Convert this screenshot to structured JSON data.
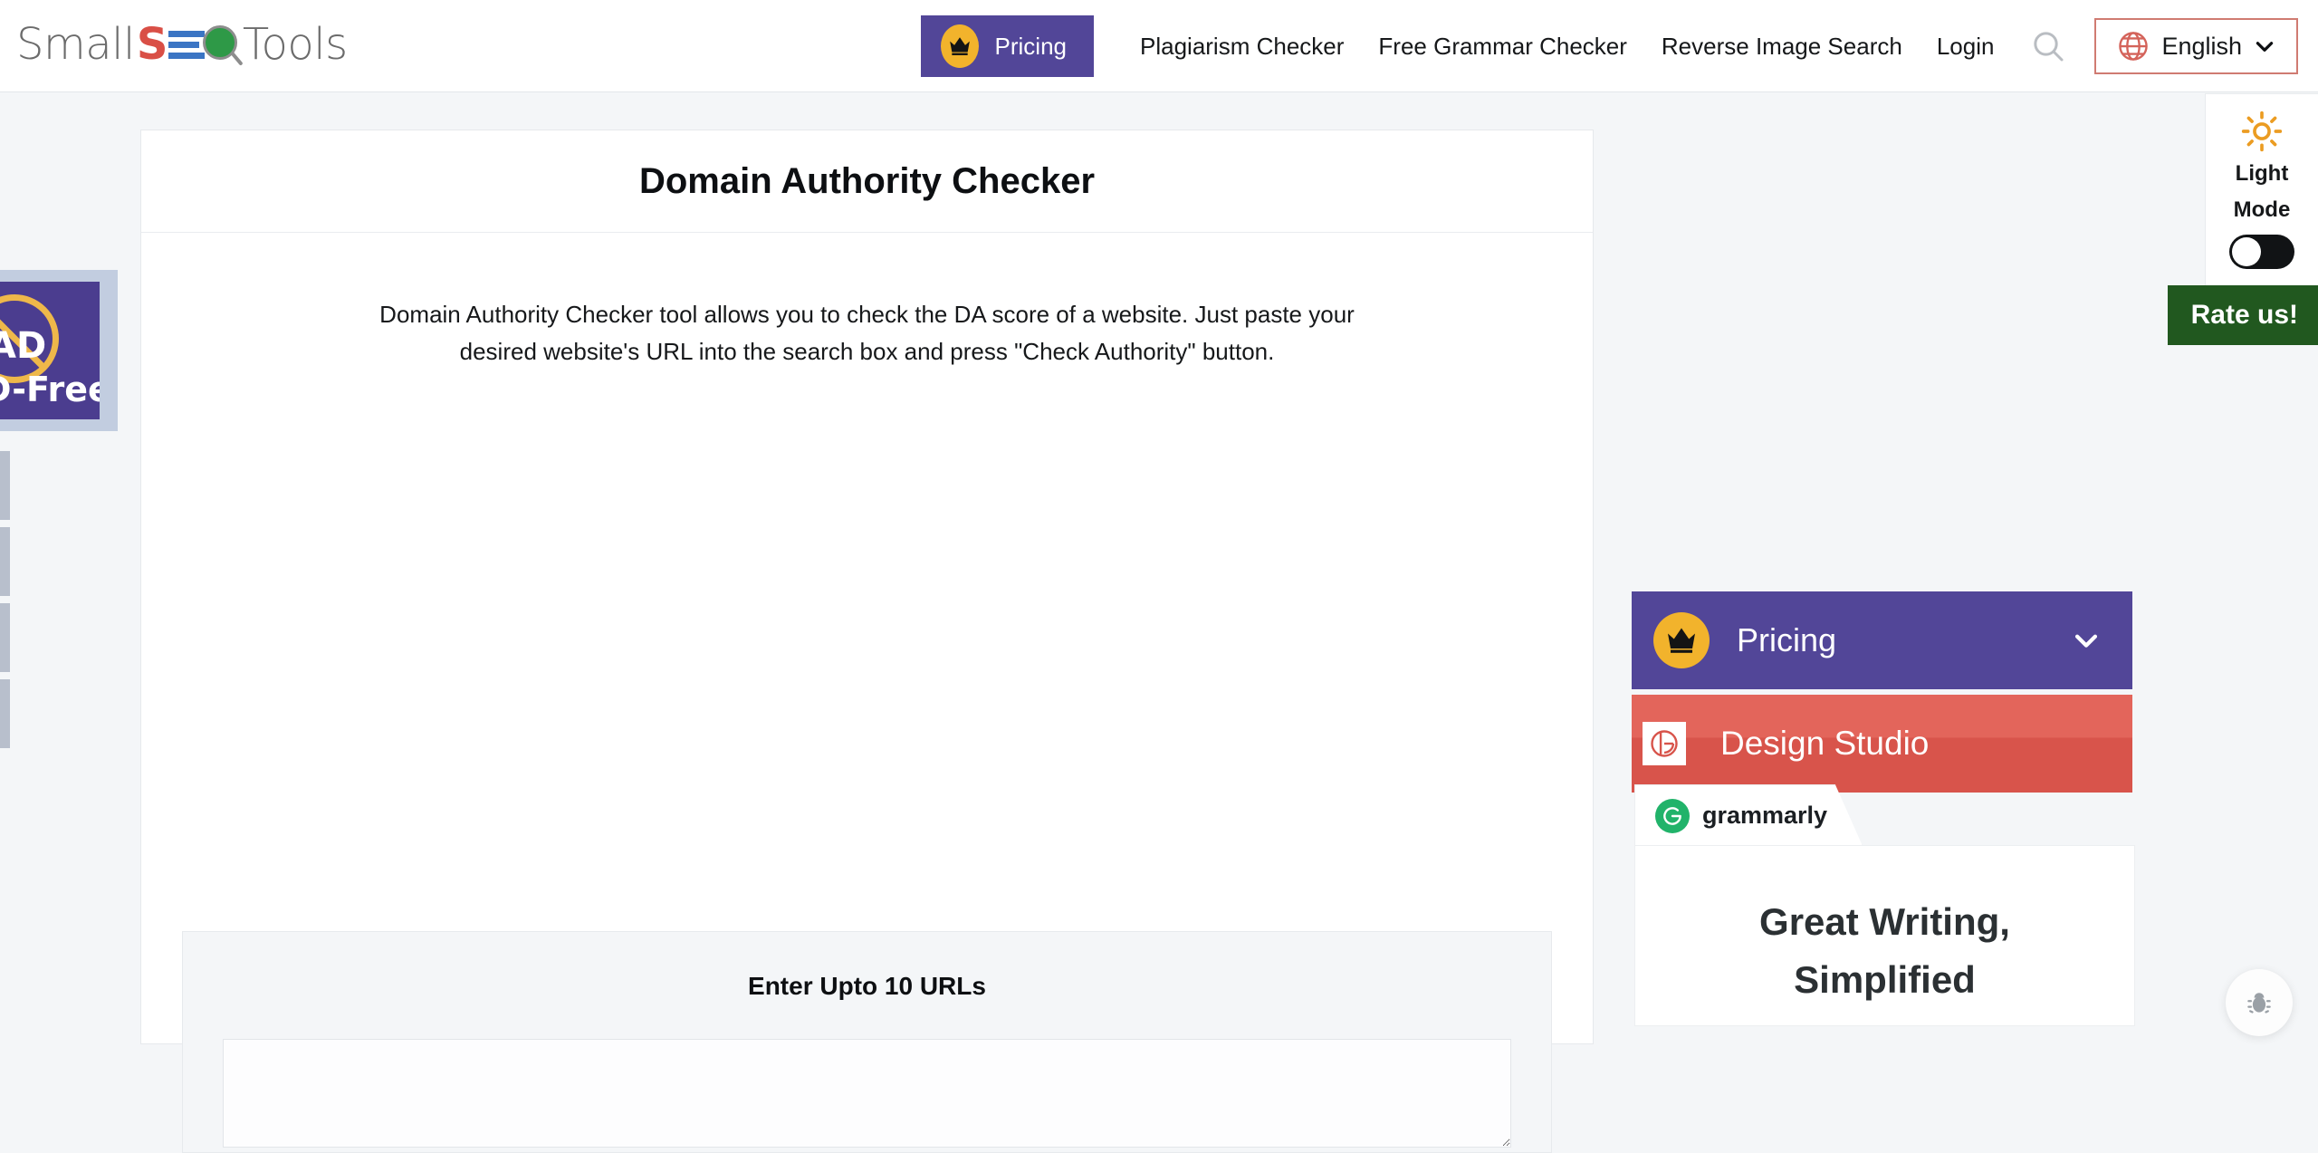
{
  "header": {
    "logo": {
      "part1": "Small",
      "part2": "S",
      "part3": "O",
      "part4": "Tools",
      "alt": "SmallSEOTools"
    },
    "pricing_button": {
      "label": "Pricing",
      "icon": "crown-icon",
      "bg": "#524698",
      "badge_color": "#f2b32c"
    },
    "nav_links": [
      {
        "label": "Plagiarism Checker"
      },
      {
        "label": "Free Grammar Checker"
      },
      {
        "label": "Reverse Image Search"
      },
      {
        "label": "Login"
      }
    ],
    "search_icon": "search-icon",
    "language": {
      "label": "English",
      "icon": "globe-icon",
      "chevron": "chevron-down-icon",
      "border_color": "#d07b72"
    }
  },
  "left_rail": {
    "ad_free_badge": {
      "line1": "AD",
      "line2": "D-Free",
      "bg": "#4b3d8f",
      "ring_color": "#eeb84a"
    },
    "tabs_count": 4
  },
  "main": {
    "title": "Domain Authority Checker",
    "description": "Domain Authority Checker tool allows you to check the DA score of a website. Just paste your desired website's URL into the search box and press \"Check Authority\" button.",
    "url_panel": {
      "heading": "Enter Upto 10 URLs",
      "textarea_value": "",
      "textarea_placeholder": ""
    }
  },
  "sidebar": {
    "pricing": {
      "label": "Pricing",
      "icon": "crown-icon",
      "chevron": "chevron-down-icon",
      "bg": "#524698"
    },
    "design_studio": {
      "label": "Design Studio",
      "icon": "design-studio-logo-icon",
      "bg": "#e3655b"
    },
    "grammarly": {
      "brand": "grammarly",
      "headline_line1": "Great Writing,",
      "headline_line2": "Simplified",
      "brand_color": "#21b36a"
    }
  },
  "light_mode_panel": {
    "icon": "sun-icon",
    "label_line1": "Light",
    "label_line2": "Mode",
    "toggle_state": "off",
    "icon_color": "#eb9c22"
  },
  "rate_us": {
    "label": "Rate us!",
    "bg": "#21581f"
  },
  "bug_report": {
    "icon": "bug-icon"
  }
}
